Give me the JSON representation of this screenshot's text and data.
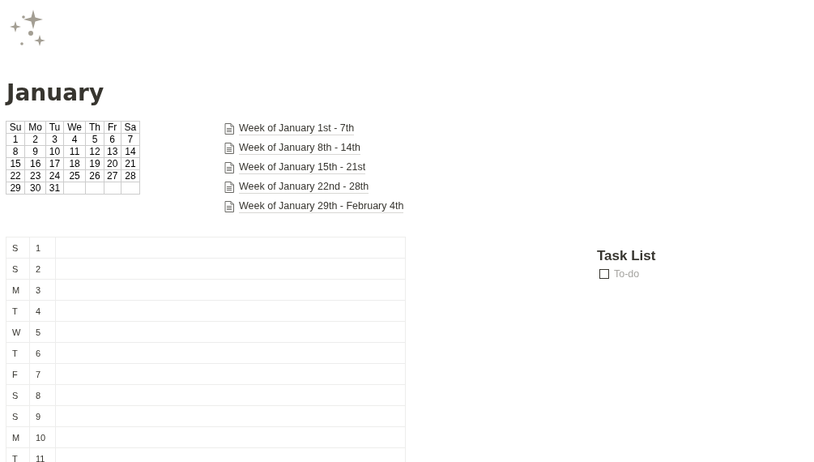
{
  "title": "January",
  "calendar": {
    "days": [
      "Su",
      "Mo",
      "Tu",
      "We",
      "Th",
      "Fr",
      "Sa"
    ],
    "weeks": [
      [
        "1",
        "2",
        "3",
        "4",
        "5",
        "6",
        "7"
      ],
      [
        "8",
        "9",
        "10",
        "11",
        "12",
        "13",
        "14"
      ],
      [
        "15",
        "16",
        "17",
        "18",
        "19",
        "20",
        "21"
      ],
      [
        "22",
        "23",
        "24",
        "25",
        "26",
        "27",
        "28"
      ],
      [
        "29",
        "30",
        "31"
      ]
    ]
  },
  "pages": [
    "Week of January 1st - 7th",
    "Week of January 8th - 14th",
    "Week of January 15th - 21st",
    "Week of January 22nd - 28th",
    "Week of January 29th - February 4th"
  ],
  "table": {
    "rows": [
      {
        "day": "S",
        "date": "1"
      },
      {
        "day": "S",
        "date": "2"
      },
      {
        "day": "M",
        "date": "3"
      },
      {
        "day": "T",
        "date": "4"
      },
      {
        "day": "W",
        "date": "5"
      },
      {
        "day": "T",
        "date": "6"
      },
      {
        "day": "F",
        "date": "7"
      },
      {
        "day": "S",
        "date": "8"
      },
      {
        "day": "S",
        "date": "9"
      },
      {
        "day": "M",
        "date": "10"
      },
      {
        "day": "T",
        "date": "11"
      }
    ]
  },
  "task_list": {
    "heading": "Task List",
    "items": [
      {
        "placeholder": "To-do",
        "checked": false
      }
    ]
  }
}
